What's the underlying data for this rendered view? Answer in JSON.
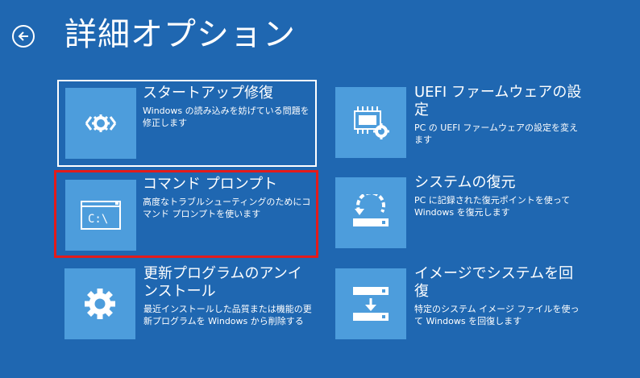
{
  "header": {
    "title": "詳細オプション"
  },
  "options": [
    {
      "title": "スタートアップ修復",
      "desc": "Windows の読み込みを妨げている問題を修正します",
      "icon": "startup-repair-icon"
    },
    {
      "title": "UEFI ファームウェアの設定",
      "desc": "PC の UEFI ファームウェアの設定を変えます",
      "icon": "uefi-firmware-icon"
    },
    {
      "title": "コマンド プロンプト",
      "desc": "高度なトラブルシューティングのためにコマンド プロンプトを使います",
      "icon": "command-prompt-icon"
    },
    {
      "title": "システムの復元",
      "desc": "PC に記録された復元ポイントを使って Windows を復元します",
      "icon": "system-restore-icon"
    },
    {
      "title": "更新プログラムのアンインストール",
      "desc": "最近インストールした品質または機能の更新プログラムを Windows から削除する",
      "icon": "gear-icon"
    },
    {
      "title": "イメージでシステムを回復",
      "desc": "特定のシステム イメージ ファイルを使って Windows を回復します",
      "icon": "system-image-icon"
    }
  ],
  "cmd_icon_text": "C:\\",
  "colors": {
    "background": "#1f67b1",
    "tile_icon_bg": "#4d9ddc",
    "highlight_border": "#e31b1b"
  }
}
